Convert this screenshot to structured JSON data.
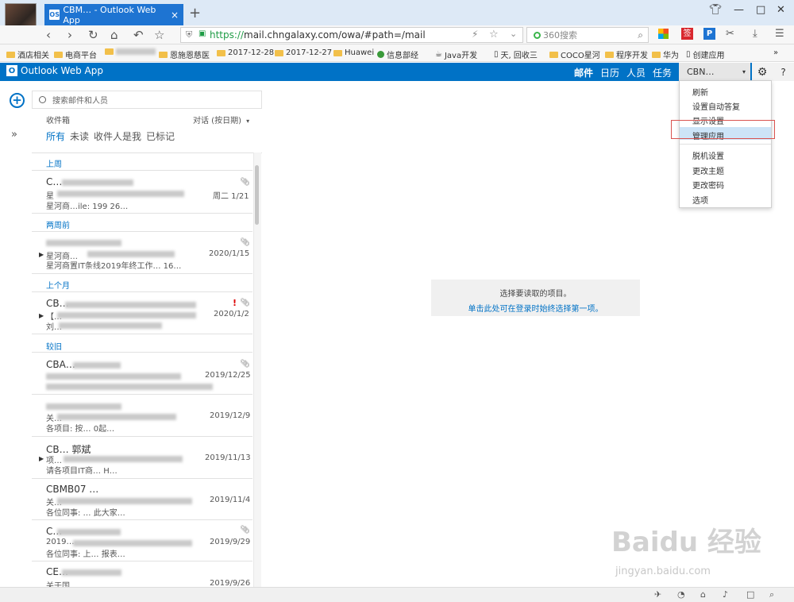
{
  "browser": {
    "tab_title": "CBM… - Outlook Web App",
    "tab_badge": "OS",
    "tab_close": "×",
    "new_tab": "+",
    "url_green": "https://",
    "url_host_path": "mail.chngalaxy.com/owa/#path=/mail",
    "search_placeholder": "360搜索",
    "bookmarks": [
      "酒店相关",
      "电商平台",
      "恩施恩慈医",
      "2017-12-28",
      "2017-12-27",
      "Huawei",
      "信息部经",
      "Java开发",
      "天, 回收三",
      "COCO星河",
      "程序开发",
      "华为",
      "创建应用"
    ],
    "more_bookmarks": "»"
  },
  "owa": {
    "app_name": "Outlook Web App",
    "logo_letter": "O",
    "nav": [
      "邮件",
      "日历",
      "人员",
      "任务"
    ],
    "user_name": "CBN…",
    "help": "?",
    "search_placeholder": "搜索邮件和人员",
    "folder": "收件箱",
    "sort": "对话 (按日期)",
    "filters": [
      "所有",
      "未读",
      "收件人是我",
      "已标记"
    ],
    "groups": [
      "上周",
      "两周前",
      "上个月",
      "较旧"
    ],
    "emails": [
      {
        "sender": "C…",
        "line2": "星",
        "line3": "星河商…ile: 199 26…",
        "date": "周二 1/21"
      },
      {
        "sender": "…",
        "line2": "星河商…",
        "line3": "星河商置IT条线2019年终工作… 16…",
        "date": "2020/1/15"
      },
      {
        "sender": "CB…",
        "line2": "【…",
        "line3": "刘…",
        "date": "2020/1/2"
      },
      {
        "sender": "CBA…",
        "line2": "…",
        "line3": "…",
        "date": "2019/12/25"
      },
      {
        "sender": "…",
        "line2": "关…",
        "line3": "各项目: 按… 0起…",
        "date": "2019/12/9"
      },
      {
        "sender": "CB… 郭斌",
        "line2": "项…",
        "line3": "请各项目IT商… H…",
        "date": "2019/11/13"
      },
      {
        "sender": "CBMB07 …",
        "line2": "关…",
        "line3": "各位同事: … 此大家…",
        "date": "2019/11/4"
      },
      {
        "sender": "C…",
        "line2": "2019…",
        "line3": "各位同事: 上… 报表…",
        "date": "2019/9/29"
      },
      {
        "sender": "CE…",
        "line2": "关于国…",
        "line3": "",
        "date": "2019/9/26"
      }
    ],
    "reading_line1": "选择要读取的项目。",
    "reading_line2": "单击此处可在登录时始终选择第一项。",
    "menu": [
      "刷新",
      "设置自动答复",
      "显示设置",
      "管理应用",
      "脱机设置",
      "更改主题",
      "更改密码",
      "选项"
    ]
  },
  "watermark": {
    "main": "Baidu 经验",
    "sub": "jingyan.baidu.com"
  },
  "colors": {
    "owa_blue": "#0072c6",
    "tab_blue": "#1e74d2",
    "highlight": "#cde4f7",
    "annotation_red": "#d9534f"
  }
}
